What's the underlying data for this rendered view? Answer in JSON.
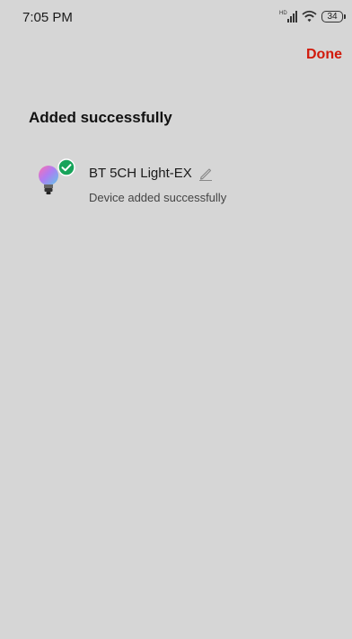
{
  "status_bar": {
    "time": "7:05 PM",
    "battery_level": "34",
    "signal_icon": "signal-icon",
    "wifi_icon": "wifi-icon",
    "battery_icon": "battery-icon"
  },
  "header": {
    "done_label": "Done",
    "done_color": "#d11a0b"
  },
  "main": {
    "title": "Added successfully",
    "devices": [
      {
        "name": "BT 5CH Light-EX",
        "status": "Device added successfully",
        "icon": "bulb-icon",
        "badge_icon": "check-badge-icon",
        "badge_color": "#17a35a",
        "edit_icon": "pencil-icon"
      }
    ]
  },
  "colors": {
    "background": "#d6d6d6"
  }
}
